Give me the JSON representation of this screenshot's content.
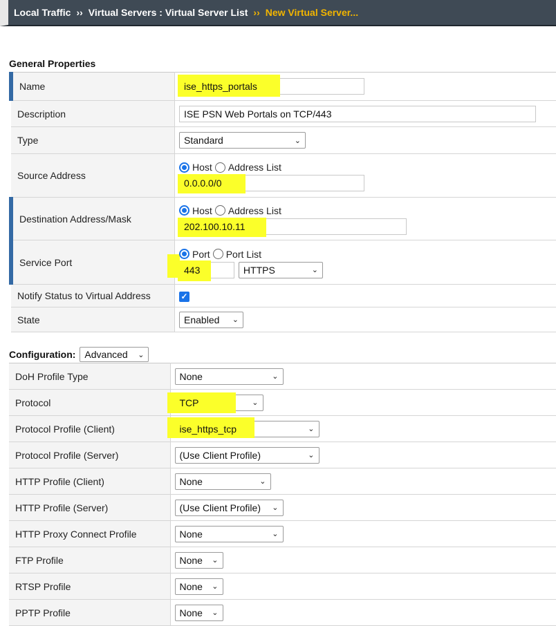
{
  "breadcrumb": {
    "items": [
      "Local Traffic",
      "Virtual Servers : Virtual Server List",
      "New Virtual Server..."
    ],
    "separator": "››"
  },
  "general": {
    "title": "General Properties",
    "name_label": "Name",
    "name_value": "ise_https_portals",
    "description_label": "Description",
    "description_value": "ISE PSN Web Portals on TCP/443",
    "type_label": "Type",
    "type_value": "Standard",
    "source_label": "Source Address",
    "source_radio_host": "Host",
    "source_radio_list": "Address List",
    "source_value": "0.0.0.0/0",
    "dest_label": "Destination Address/Mask",
    "dest_radio_host": "Host",
    "dest_radio_list": "Address List",
    "dest_value": "202.100.10.11",
    "port_label": "Service Port",
    "port_radio_port": "Port",
    "port_radio_list": "Port List",
    "port_value": "443",
    "port_service": "HTTPS",
    "notify_label": "Notify Status to Virtual Address",
    "state_label": "State",
    "state_value": "Enabled"
  },
  "configuration": {
    "title": "Configuration:",
    "mode": "Advanced",
    "rows": [
      {
        "label": "DoH Profile Type",
        "value": "None"
      },
      {
        "label": "Protocol",
        "value": "TCP"
      },
      {
        "label": "Protocol Profile (Client)",
        "value": "ise_https_tcp"
      },
      {
        "label": "Protocol Profile (Server)",
        "value": "(Use Client Profile)"
      },
      {
        "label": "HTTP Profile (Client)",
        "value": "None"
      },
      {
        "label": "HTTP Profile (Server)",
        "value": "(Use Client Profile)"
      },
      {
        "label": "HTTP Proxy Connect Profile",
        "value": "None"
      },
      {
        "label": "FTP Profile",
        "value": "None"
      },
      {
        "label": "RTSP Profile",
        "value": "None"
      },
      {
        "label": "PPTP Profile",
        "value": "None"
      }
    ]
  },
  "colors": {
    "highlight": "#fbff2a",
    "accent": "#346aa5",
    "breadcrumb_current": "#f2b500"
  }
}
